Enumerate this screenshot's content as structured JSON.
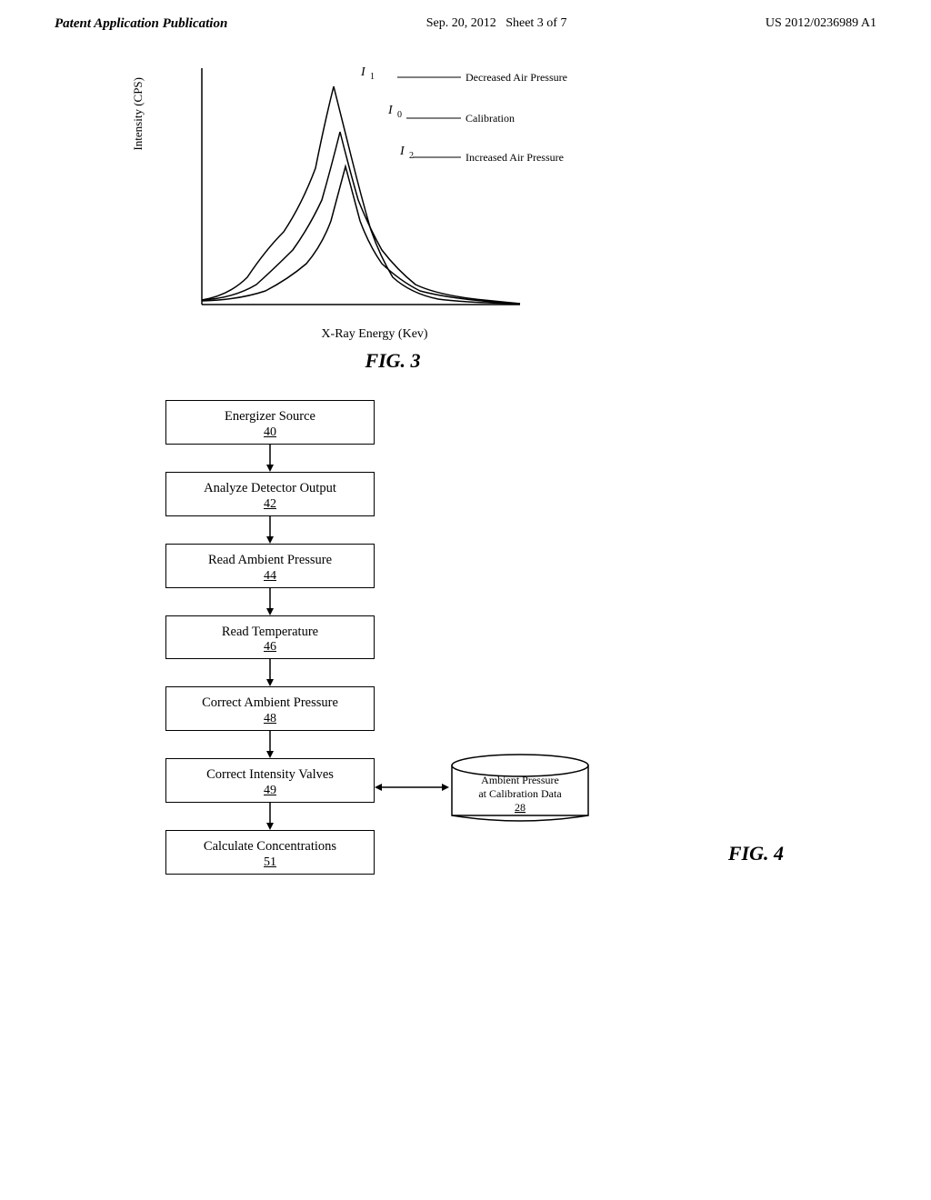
{
  "header": {
    "left": "Patent Application Publication",
    "center_date": "Sep. 20, 2012",
    "center_sheet": "Sheet 3 of 7",
    "right": "US 2012/0236989 A1"
  },
  "fig3": {
    "caption": "FIG. 3",
    "y_axis_label": "Intensity (CPS)",
    "x_axis_label": "X-Ray Energy (Kev)",
    "legend": [
      {
        "id": "decreased",
        "label": "Decreased Air Pressure",
        "symbol": "I1"
      },
      {
        "id": "calibration",
        "label": "Calibration",
        "symbol": "I0"
      },
      {
        "id": "increased",
        "label": "Increased Air Pressure",
        "symbol": "I2"
      }
    ]
  },
  "fig4": {
    "caption": "FIG. 4",
    "flowchart": [
      {
        "id": "box-energizer",
        "title": "Energizer Source",
        "num": "40"
      },
      {
        "id": "box-analyze",
        "title": "Analyze Detector Output",
        "num": "42"
      },
      {
        "id": "box-read-pressure",
        "title": "Read Ambient Pressure",
        "num": "44"
      },
      {
        "id": "box-read-temp",
        "title": "Read Temperature",
        "num": "46"
      },
      {
        "id": "box-correct-pressure",
        "title": "Correct Ambient Pressure",
        "num": "48"
      },
      {
        "id": "box-correct-intensity",
        "title": "Correct Intensity Valves",
        "num": "49"
      },
      {
        "id": "box-calculate",
        "title": "Calculate Concentrations",
        "num": "51"
      }
    ],
    "database": {
      "title": "Ambient Pressure\nat Calibration Data",
      "num": "28"
    }
  }
}
